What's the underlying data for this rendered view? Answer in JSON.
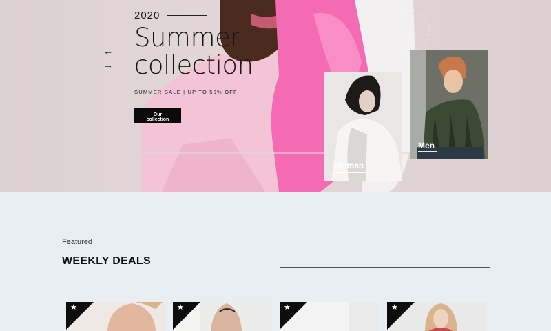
{
  "hero": {
    "year": "2020",
    "headline_line1": "Summer",
    "headline_line2": "collection",
    "sale_text": "SUMMER SALE | UP TO 50% OFF",
    "cta_label": "Our collection",
    "prev_arrow": "←",
    "next_arrow": "→",
    "categories": [
      {
        "label": "Woman"
      },
      {
        "label": "Men"
      }
    ]
  },
  "featured": {
    "eyebrow": "Featured",
    "title": "WEEKLY DEALS",
    "badge_icon": "★"
  },
  "colors": {
    "hero_bg": "#ddd2d3",
    "section_bg": "#e9eef2",
    "pink": "#f06fb6",
    "dark": "#0b0b0b"
  },
  "icons": [
    "arrow-left-icon",
    "arrow-right-icon",
    "star-icon"
  ]
}
